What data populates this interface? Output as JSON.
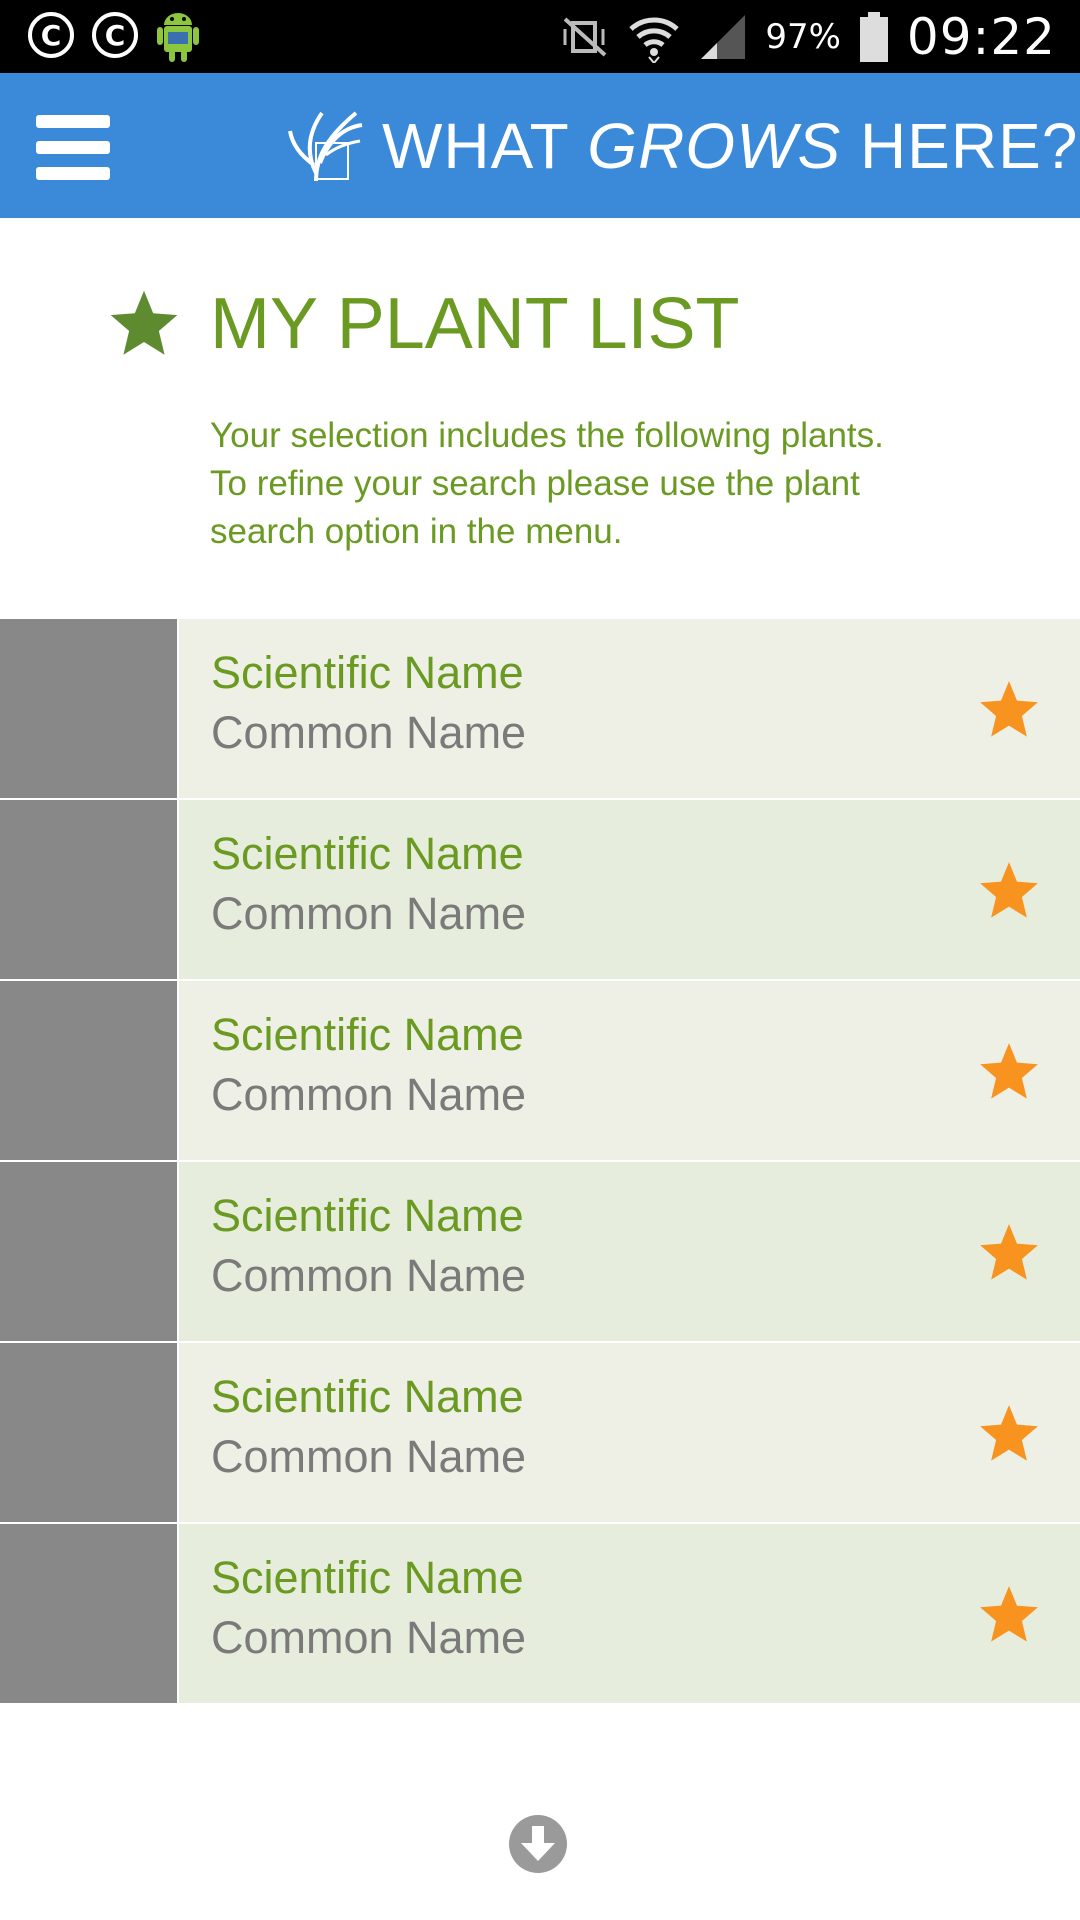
{
  "status_bar": {
    "left_icons": [
      "copyright-icon",
      "copyright-icon",
      "android-icon"
    ],
    "right_icons": [
      "vibrate-off-icon",
      "wifi-icon",
      "signal-icon",
      "battery-icon"
    ],
    "battery": "97%",
    "time": "09:22"
  },
  "app_bar": {
    "menu_icon": "hamburger-menu-icon",
    "logo_icon": "plant-logo-icon",
    "title_part1": "WHAT ",
    "title_part2": "GROWS",
    "title_part3": " HERE?"
  },
  "page": {
    "title_icon": "star-icon",
    "title": "MY PLANT LIST",
    "intro_line1": "Your selection includes the following plants.",
    "intro_line2": "To refine your search please use the plant",
    "intro_line3": "search option in the menu."
  },
  "plants": [
    {
      "scientific": "Scientific Name",
      "common": "Common Name"
    },
    {
      "scientific": "Scientific Name",
      "common": "Common Name"
    },
    {
      "scientific": "Scientific Name",
      "common": "Common Name"
    },
    {
      "scientific": "Scientific Name",
      "common": "Common Name"
    },
    {
      "scientific": "Scientific Name",
      "common": "Common Name"
    },
    {
      "scientific": "Scientific Name",
      "common": "Common Name"
    }
  ],
  "footer": {
    "scroll_icon": "arrow-down-circle-icon"
  },
  "colors": {
    "app_bar": "#3b8ad9",
    "green": "#6a9a22",
    "heading_star": "#5e8a30",
    "favorite_star": "#f7931e",
    "thumb": "#888888"
  }
}
